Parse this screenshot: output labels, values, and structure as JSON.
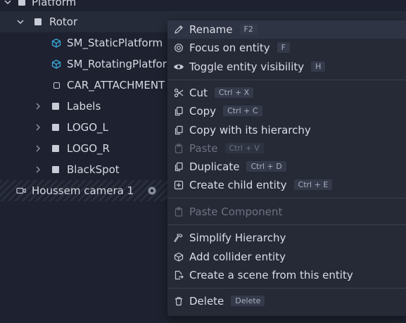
{
  "tree": {
    "items": [
      {
        "label": "Platform",
        "icon": "square-icon"
      },
      {
        "label": "Rotor",
        "icon": "square-icon"
      },
      {
        "label": "SM_StaticPlatform",
        "icon": "mesh-cube-icon"
      },
      {
        "label": "SM_RotatingPlatform",
        "icon": "mesh-cube-icon"
      },
      {
        "label": "CAR_ATTACHMENT",
        "icon": "square-outline-icon"
      },
      {
        "label": "Labels",
        "icon": "square-icon"
      },
      {
        "label": "LOGO_L",
        "icon": "square-icon"
      },
      {
        "label": "LOGO_R",
        "icon": "square-icon"
      },
      {
        "label": "BlackSpot",
        "icon": "square-icon"
      },
      {
        "label": "Houssem camera 1",
        "icon": "camera-icon"
      }
    ]
  },
  "context_menu": {
    "rename": {
      "label": "Rename",
      "shortcut": "F2"
    },
    "focus": {
      "label": "Focus on entity",
      "shortcut": "F"
    },
    "toggle_visibility": {
      "label": "Toggle entity visibility",
      "shortcut": "H"
    },
    "cut": {
      "label": "Cut",
      "shortcut": "Ctrl + X"
    },
    "copy": {
      "label": "Copy",
      "shortcut": "Ctrl + C"
    },
    "copy_hierarchy": {
      "label": "Copy with its hierarchy"
    },
    "paste": {
      "label": "Paste",
      "shortcut": "Ctrl + V",
      "disabled": true
    },
    "duplicate": {
      "label": "Duplicate",
      "shortcut": "Ctrl + D"
    },
    "create_child": {
      "label": "Create child entity",
      "shortcut": "Ctrl + E"
    },
    "paste_component": {
      "label": "Paste Component",
      "disabled": true
    },
    "simplify": {
      "label": "Simplify Hierarchy"
    },
    "add_collider": {
      "label": "Add collider entity"
    },
    "create_scene": {
      "label": "Create a scene from this entity"
    },
    "delete": {
      "label": "Delete",
      "shortcut": "Delete"
    }
  },
  "colors": {
    "background": "#1e2230",
    "menu_bg": "#262a37",
    "mesh_icon": "#3aa7d9",
    "text": "#d6d9e2",
    "disabled_text": "#6c7180"
  }
}
